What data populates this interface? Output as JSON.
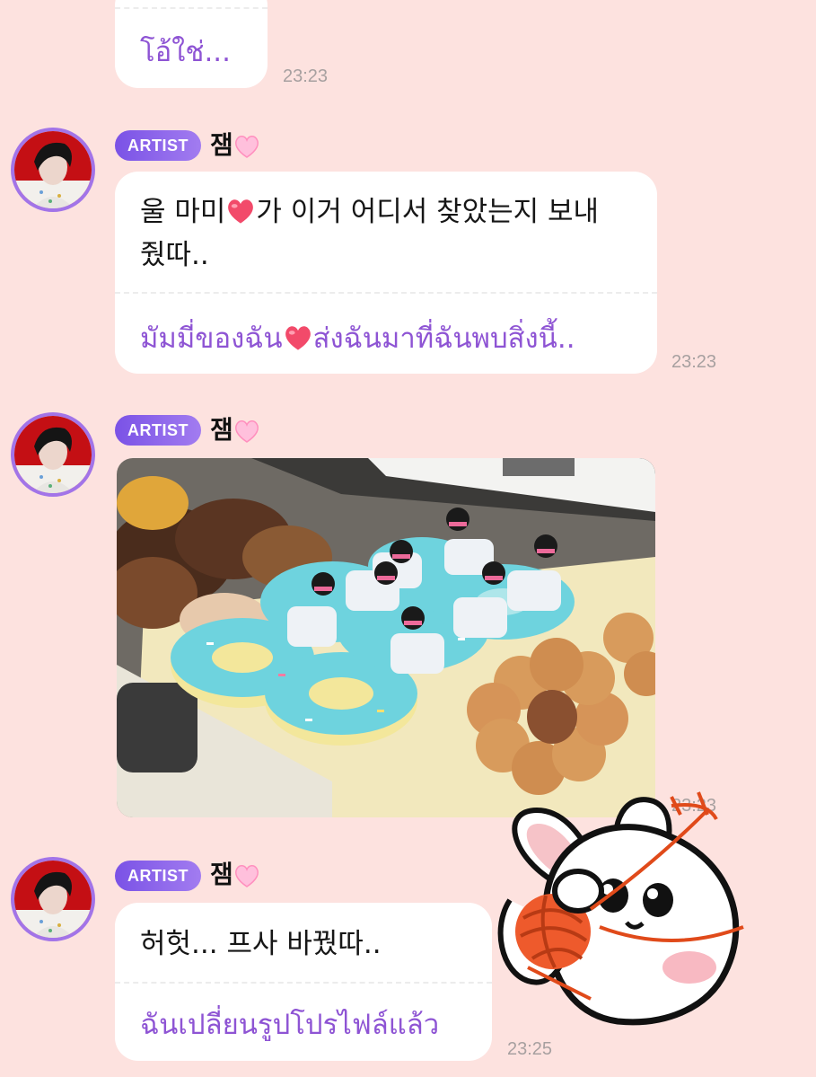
{
  "messages": [
    {
      "translation": "โอ้ใช่...",
      "time": "23:23"
    },
    {
      "badge": "ARTIST",
      "sender": "잼",
      "original_part1": "울 마미",
      "original_part2": "가 이거 어디서 찾았는지 보내",
      "original_line2": "줬따..",
      "translation_part1": "มัมมี่ของฉัน",
      "translation_part2": "ส่งฉันมาที่ฉันพบสิ่งนี้..",
      "time": "23:23"
    },
    {
      "badge": "ARTIST",
      "sender": "잼",
      "image_icon": "donut-photo",
      "time": "23:23"
    },
    {
      "badge": "ARTIST",
      "sender": "잼",
      "original": "허헛... 프사 바꿨따..",
      "translation": "ฉันเปลี่ยนรูปโปรไฟล์แล้ว",
      "time": "23:25"
    }
  ],
  "sticker_icon": "bunny-yarn-sticker",
  "colors": {
    "background": "#fde2df",
    "translation": "#8e54d4",
    "badge": "#8a62ec",
    "heart": "#ff6fa8"
  }
}
